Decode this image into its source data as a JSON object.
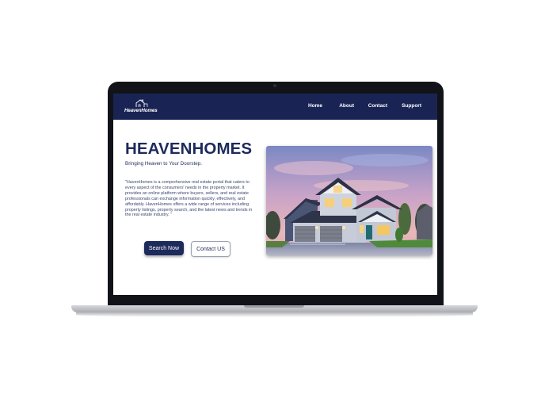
{
  "site": {
    "logo_text": "HeavenHomes",
    "nav": [
      "Home",
      "About",
      "Contact",
      "Support"
    ]
  },
  "hero": {
    "title": "HEAVENHOMES",
    "tagline": "Bringing Heaven to Your Doorstep.",
    "description": "\"HavenHomes is a comprehensive real estate portal that caters to every aspect of the consumers' needs in the property market. It provides an online platform where buyers, sellers, and real estate professionals can exchange information quickly, effectively, and affordably. HavenHomes offers a wide range of services including property listings, property search, and the latest news and trends in the real estate industry. \"",
    "search_button": "Search Now",
    "contact_button": "Contact US"
  },
  "colors": {
    "brand_navy": "#192454",
    "text_navy": "#1d2a5c"
  }
}
